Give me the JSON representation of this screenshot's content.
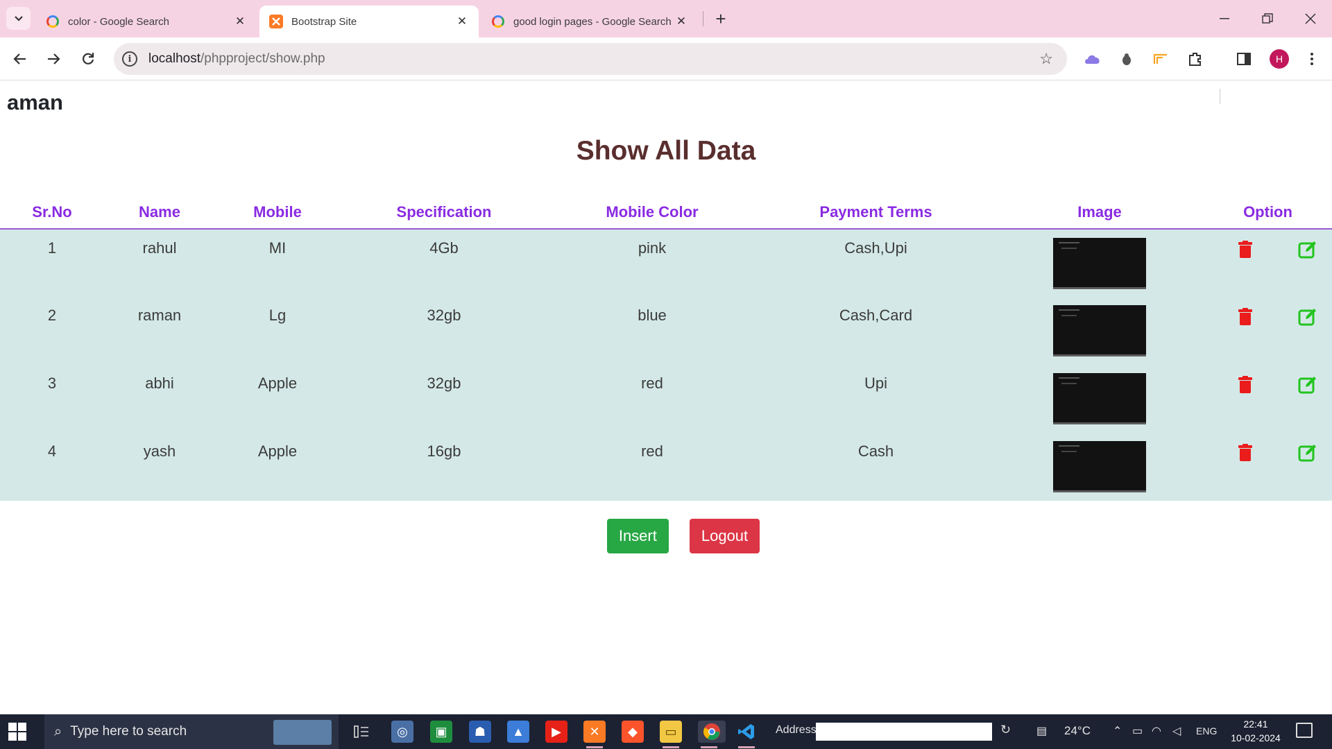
{
  "browser": {
    "tabs": [
      {
        "title": "color - Google Search",
        "favicon": "google-icon",
        "active": false
      },
      {
        "title": "Bootstrap Site",
        "favicon": "xampp-icon",
        "active": true
      },
      {
        "title": "good login pages - Google Search",
        "favicon": "google-icon",
        "active": false
      }
    ],
    "url_host": "localhost",
    "url_path": "/phpproject/show.php",
    "profile_initial": "H"
  },
  "page": {
    "username": "aman",
    "heading": "Show All Data",
    "table": {
      "columns": [
        "Sr.No",
        "Name",
        "Mobile",
        "Specification",
        "Mobile Color",
        "Payment Terms",
        "Image",
        "Option"
      ],
      "rows": [
        {
          "sr": "1",
          "name": "rahul",
          "mobile": "MI",
          "spec": "4Gb",
          "color": "pink",
          "payment": "Cash,Upi"
        },
        {
          "sr": "2",
          "name": "raman",
          "mobile": "Lg",
          "spec": "32gb",
          "color": "blue",
          "payment": "Cash,Card"
        },
        {
          "sr": "3",
          "name": "abhi",
          "mobile": "Apple",
          "spec": "32gb",
          "color": "red",
          "payment": "Upi"
        },
        {
          "sr": "4",
          "name": "yash",
          "mobile": "Apple",
          "spec": "16gb",
          "color": "red",
          "payment": "Cash"
        }
      ]
    },
    "buttons": {
      "insert": "Insert",
      "logout": "Logout"
    },
    "colors": {
      "header_text": "#8a2be2",
      "row_bg": "#d4e9e7",
      "delete": "#ea1c1c",
      "edit": "#22c41e",
      "insert": "#28a745",
      "logout": "#dc3545"
    }
  },
  "taskbar": {
    "search_placeholder": "Type here to search",
    "address_label": "Address",
    "temperature": "24°C",
    "language": "ENG",
    "time": "22:41",
    "date": "10-02-2024"
  }
}
